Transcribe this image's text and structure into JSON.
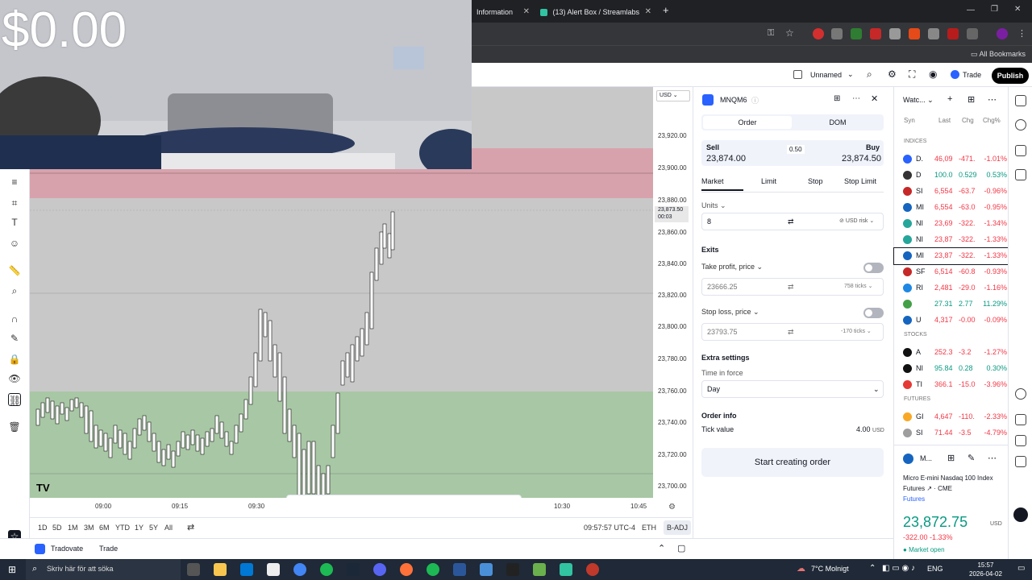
{
  "browser": {
    "tabs": [
      {
        "label": "Information"
      },
      {
        "label": "(13) Alert Box / Streamlabs"
      }
    ],
    "new_tab": "+",
    "bookmarks_label": "All Bookmarks"
  },
  "overlay": {
    "balance": "$0.00"
  },
  "header": {
    "layout_name": "Unnamed",
    "trade_label": "Trade",
    "publish_label": "Publish"
  },
  "chart": {
    "currency": "USD",
    "current_price": "23,873.50",
    "countdown": "00:03",
    "price_ticks": [
      "23,920.00",
      "23,900.00",
      "23,880.00",
      "23,860.00",
      "23,840.00",
      "23,820.00",
      "23,800.00",
      "23,780.00",
      "23,760.00",
      "23,740.00",
      "23,720.00",
      "23,700.00"
    ],
    "time_ticks": [
      "09:00",
      "09:15",
      "09:30",
      "10:30",
      "10:45"
    ],
    "timestamp": "09:57:57 UTC-4",
    "session": "ETH",
    "adj": "B-ADJ",
    "ranges": [
      "1D",
      "5D",
      "1M",
      "3M",
      "6M",
      "YTD",
      "1Y",
      "5Y",
      "All"
    ],
    "bottom_tabs": [
      "Tradovate",
      "Trade"
    ]
  },
  "order_panel": {
    "symbol": "MNQM6",
    "tabs": [
      "Order",
      "DOM"
    ],
    "sell_label": "Sell",
    "sell_price": "23,874.00",
    "spread": "0.50",
    "buy_label": "Buy",
    "buy_price": "23,874.50",
    "order_types": [
      "Market",
      "Limit",
      "Stop",
      "Stop Limit"
    ],
    "units_label": "Units",
    "units_value": "8",
    "risk_label": "USD risk",
    "exits_label": "Exits",
    "tp_label": "Take profit, price",
    "tp_value": "23666.25",
    "tp_ticks": "758 ticks",
    "sl_label": "Stop loss, price",
    "sl_value": "23793.75",
    "sl_ticks": "-170 ticks",
    "extra_label": "Extra settings",
    "tif_label": "Time in force",
    "tif_value": "Day",
    "info_label": "Order info",
    "tick_value_label": "Tick value",
    "tick_value": "4.00",
    "tick_value_unit": "USD",
    "submit_label": "Start creating order"
  },
  "watchlist": {
    "title": "Watc...",
    "columns": [
      "Syn",
      "Last",
      "Chg",
      "Chg%"
    ],
    "sections": [
      {
        "name": "INDICES",
        "rows": [
          {
            "sym": "D.",
            "last": "46,09",
            "chg": "-471.",
            "pct": "-1.01%",
            "color": "#2962ff"
          },
          {
            "sym": "D",
            "last": "100.0",
            "chg": "0.529",
            "pct": "0.53%",
            "color": "#333333"
          },
          {
            "sym": "SI",
            "last": "6,554",
            "chg": "-63.7",
            "pct": "-0.96%",
            "color": "#c62828"
          },
          {
            "sym": "MI",
            "last": "6,554",
            "chg": "-63.0",
            "pct": "-0.95%",
            "color": "#1565c0"
          },
          {
            "sym": "NI",
            "last": "23,69",
            "chg": "-322.",
            "pct": "-1.34%",
            "color": "#26a69a"
          },
          {
            "sym": "NI",
            "last": "23,87",
            "chg": "-322.",
            "pct": "-1.33%",
            "color": "#26a69a"
          },
          {
            "sym": "MI",
            "last": "23,87",
            "chg": "-322.",
            "pct": "-1.33%",
            "color": "#1565c0"
          },
          {
            "sym": "SF",
            "last": "6,514",
            "chg": "-60.8",
            "pct": "-0.93%",
            "color": "#c62828"
          },
          {
            "sym": "RI",
            "last": "2,481",
            "chg": "-29.0",
            "pct": "-1.16%",
            "color": "#1e88e5"
          },
          {
            "sym": "",
            "last": "27.31",
            "chg": "2.77",
            "pct": "11.29%",
            "color": "#43a047"
          },
          {
            "sym": "U",
            "last": "4,317",
            "chg": "-0.00",
            "pct": "-0.09%",
            "color": "#1565c0"
          }
        ]
      },
      {
        "name": "STOCKS",
        "rows": [
          {
            "sym": "A",
            "last": "252.3",
            "chg": "-3.2",
            "pct": "-1.27%",
            "color": "#111111"
          },
          {
            "sym": "NI",
            "last": "95.84",
            "chg": "0.28",
            "pct": "0.30%",
            "color": "#111111"
          },
          {
            "sym": "TI",
            "last": "366.1",
            "chg": "-15.0",
            "pct": "-3.96%",
            "color": "#e53935"
          }
        ]
      },
      {
        "name": "FUTURES",
        "rows": [
          {
            "sym": "GI",
            "last": "4,647",
            "chg": "-110.",
            "pct": "-2.33%",
            "color": "#f9a825"
          },
          {
            "sym": "SI",
            "last": "71.44",
            "chg": "-3.5",
            "pct": "-4.79%",
            "color": "#9e9e9e"
          }
        ]
      }
    ],
    "detail": {
      "sym": "M...",
      "name": "Micro E-mini Nasdaq 100 Index Futures",
      "exchange": "CME",
      "type": "Futures",
      "price": "23,872.75",
      "currency": "USD",
      "change": "-322.00",
      "change_pct": "-1.33%",
      "status": "Market open"
    }
  },
  "taskbar": {
    "search_placeholder": "Skriv här för att söka",
    "weather": "7°C Molnigt",
    "lang": "ENG",
    "time": "15:57",
    "date": "2026-04-02"
  }
}
